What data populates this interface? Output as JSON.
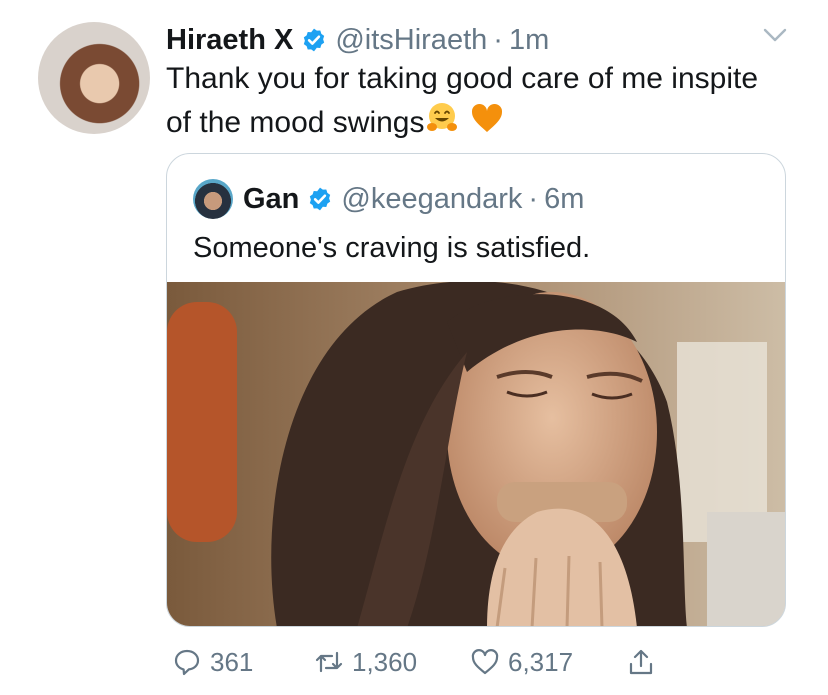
{
  "tweet": {
    "author_name": "Hiraeth X",
    "author_handle": "@itsHiraeth",
    "separator": "·",
    "timestamp": "1m",
    "text": "Thank you for taking good care of me inspite of the mood swings",
    "emojis": [
      "hugging-face-emoji",
      "orange-heart-emoji"
    ]
  },
  "quoted_tweet": {
    "author_name": "Gan",
    "author_handle": "@keegandark",
    "separator": "·",
    "timestamp": "6m",
    "text": "Someone's craving is satisfied."
  },
  "actions": {
    "replies": "361",
    "retweets": "1,360",
    "likes": "6,317"
  },
  "icons": {
    "verified": "verified-badge-icon",
    "more": "chevron-down-icon",
    "reply": "reply-icon",
    "retweet": "retweet-icon",
    "like": "heart-icon",
    "share": "share-icon"
  },
  "colors": {
    "verified": "#1da1f2",
    "secondary_text": "#657786",
    "border": "#ccd6dd"
  }
}
